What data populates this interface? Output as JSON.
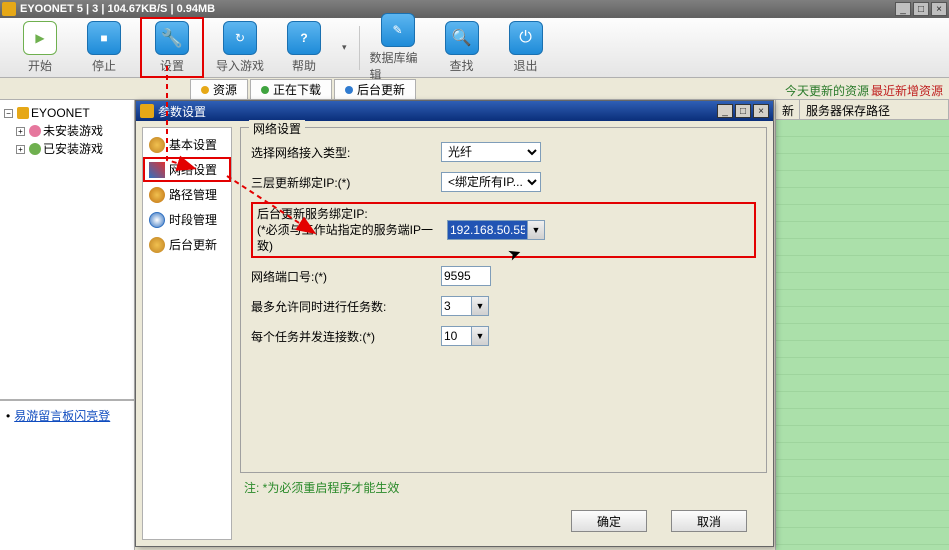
{
  "titlebar": {
    "text": "EYOONET 5 | 3 | 104.67KB/S | 0.94MB"
  },
  "toolbar": {
    "start": "开始",
    "stop": "停止",
    "settings": "设置",
    "import": "导入游戏",
    "help": "帮助",
    "dbedit": "数据库编辑",
    "find": "查找",
    "exit": "退出"
  },
  "tabs": {
    "resources": "资源",
    "downloading": "正在下载",
    "bgupdate": "后台更新"
  },
  "rightStatus": {
    "green": "今天更新的资源",
    "red": "最近新增资源"
  },
  "tree": {
    "root": "EYOONET",
    "uninstalled": "未安装游戏",
    "installed": "已安装游戏"
  },
  "bulletin": {
    "link": "易游留言板闪亮登"
  },
  "rightHeader": {
    "col1": "新",
    "col2": "服务器保存路径"
  },
  "dialog": {
    "title": "参数设置",
    "nav": {
      "basic": "基本设置",
      "network": "网络设置",
      "path": "路径管理",
      "time": "时段管理",
      "bg": "后台更新"
    },
    "group": "网络设置",
    "labels": {
      "netType": "选择网络接入类型:",
      "bindIp": "三层更新绑定IP:(*)",
      "bgIp1": "后台更新服务绑定IP:",
      "bgIp2": "(*必须与工作站指定的服务端IP一致)",
      "port": "网络端口号:(*)",
      "maxTasks": "最多允许同时进行任务数:",
      "connPerTask": "每个任务并发连接数:(*)"
    },
    "values": {
      "netType": "光纤",
      "bindIp": "<绑定所有IP...>",
      "bgIp": "192.168.50.55",
      "port": "9595",
      "maxTasks": "3",
      "connPerTask": "10"
    },
    "note": "注: *为必须重启程序才能生效",
    "ok": "确定",
    "cancel": "取消"
  }
}
